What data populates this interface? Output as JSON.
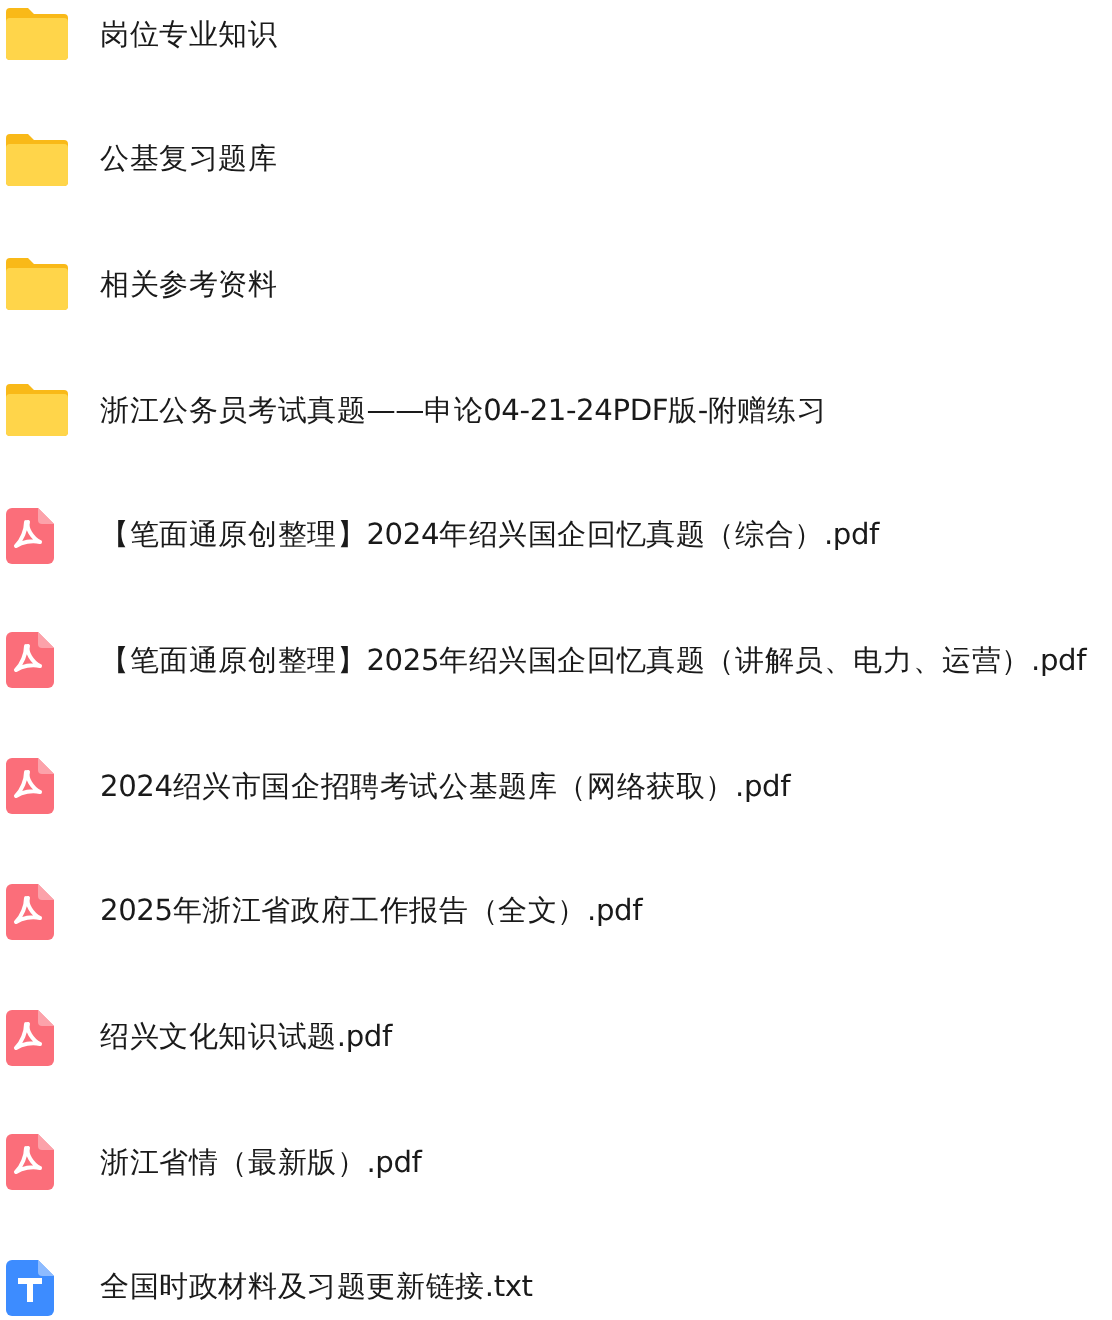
{
  "files": [
    {
      "kind": "folder",
      "name": "岗位专业知识"
    },
    {
      "kind": "folder",
      "name": "公基复习题库"
    },
    {
      "kind": "folder",
      "name": "相关参考资料"
    },
    {
      "kind": "folder",
      "name": "浙江公务员考试真题——申论04-21-24PDF版-附赠练习"
    },
    {
      "kind": "pdf",
      "name": "【笔面通原创整理】2024年绍兴国企回忆真题（综合）.pdf"
    },
    {
      "kind": "pdf",
      "name": "【笔面通原创整理】2025年绍兴国企回忆真题（讲解员、电力、运营）.pdf"
    },
    {
      "kind": "pdf",
      "name": "2024绍兴市国企招聘考试公基题库（网络获取）.pdf"
    },
    {
      "kind": "pdf",
      "name": "2025年浙江省政府工作报告（全文）.pdf"
    },
    {
      "kind": "pdf",
      "name": "绍兴文化知识试题.pdf"
    },
    {
      "kind": "pdf",
      "name": "浙江省情（最新版）.pdf"
    },
    {
      "kind": "txt",
      "name": "全国时政材料及习题更新链接.txt"
    }
  ]
}
